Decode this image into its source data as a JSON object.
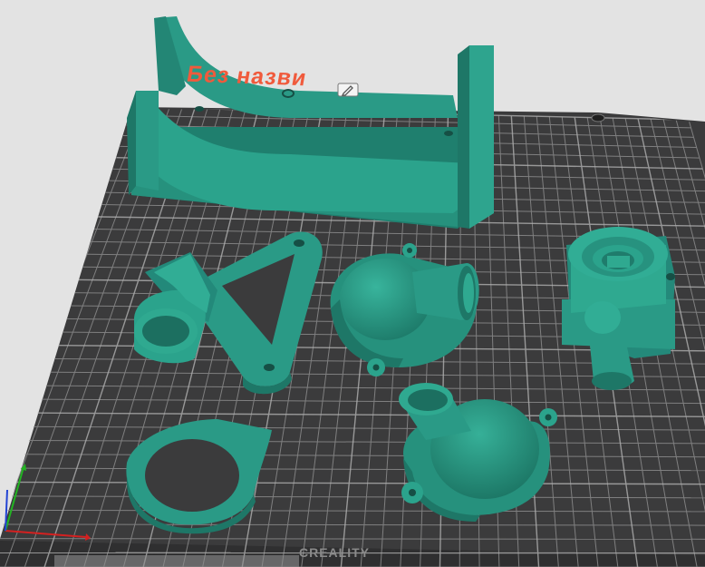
{
  "plate": {
    "label": "Без назви",
    "brand": "CREALITY"
  },
  "icons": {
    "edit": "pencil-edit-icon",
    "axis": "xyz-axis-icon"
  },
  "colors": {
    "background": "#e3e3e3",
    "bed": "#3b3b3c",
    "grid": "#8c8c8c",
    "model": "#2a9a86",
    "label": "#f05a3c",
    "axis_x": "#d42020",
    "axis_y": "#22b422",
    "axis_z": "#2244d4"
  },
  "models": [
    "bracket",
    "swing-arm",
    "shell-dome-a",
    "pump-housing",
    "shell-dome-b",
    "flange-ring"
  ]
}
